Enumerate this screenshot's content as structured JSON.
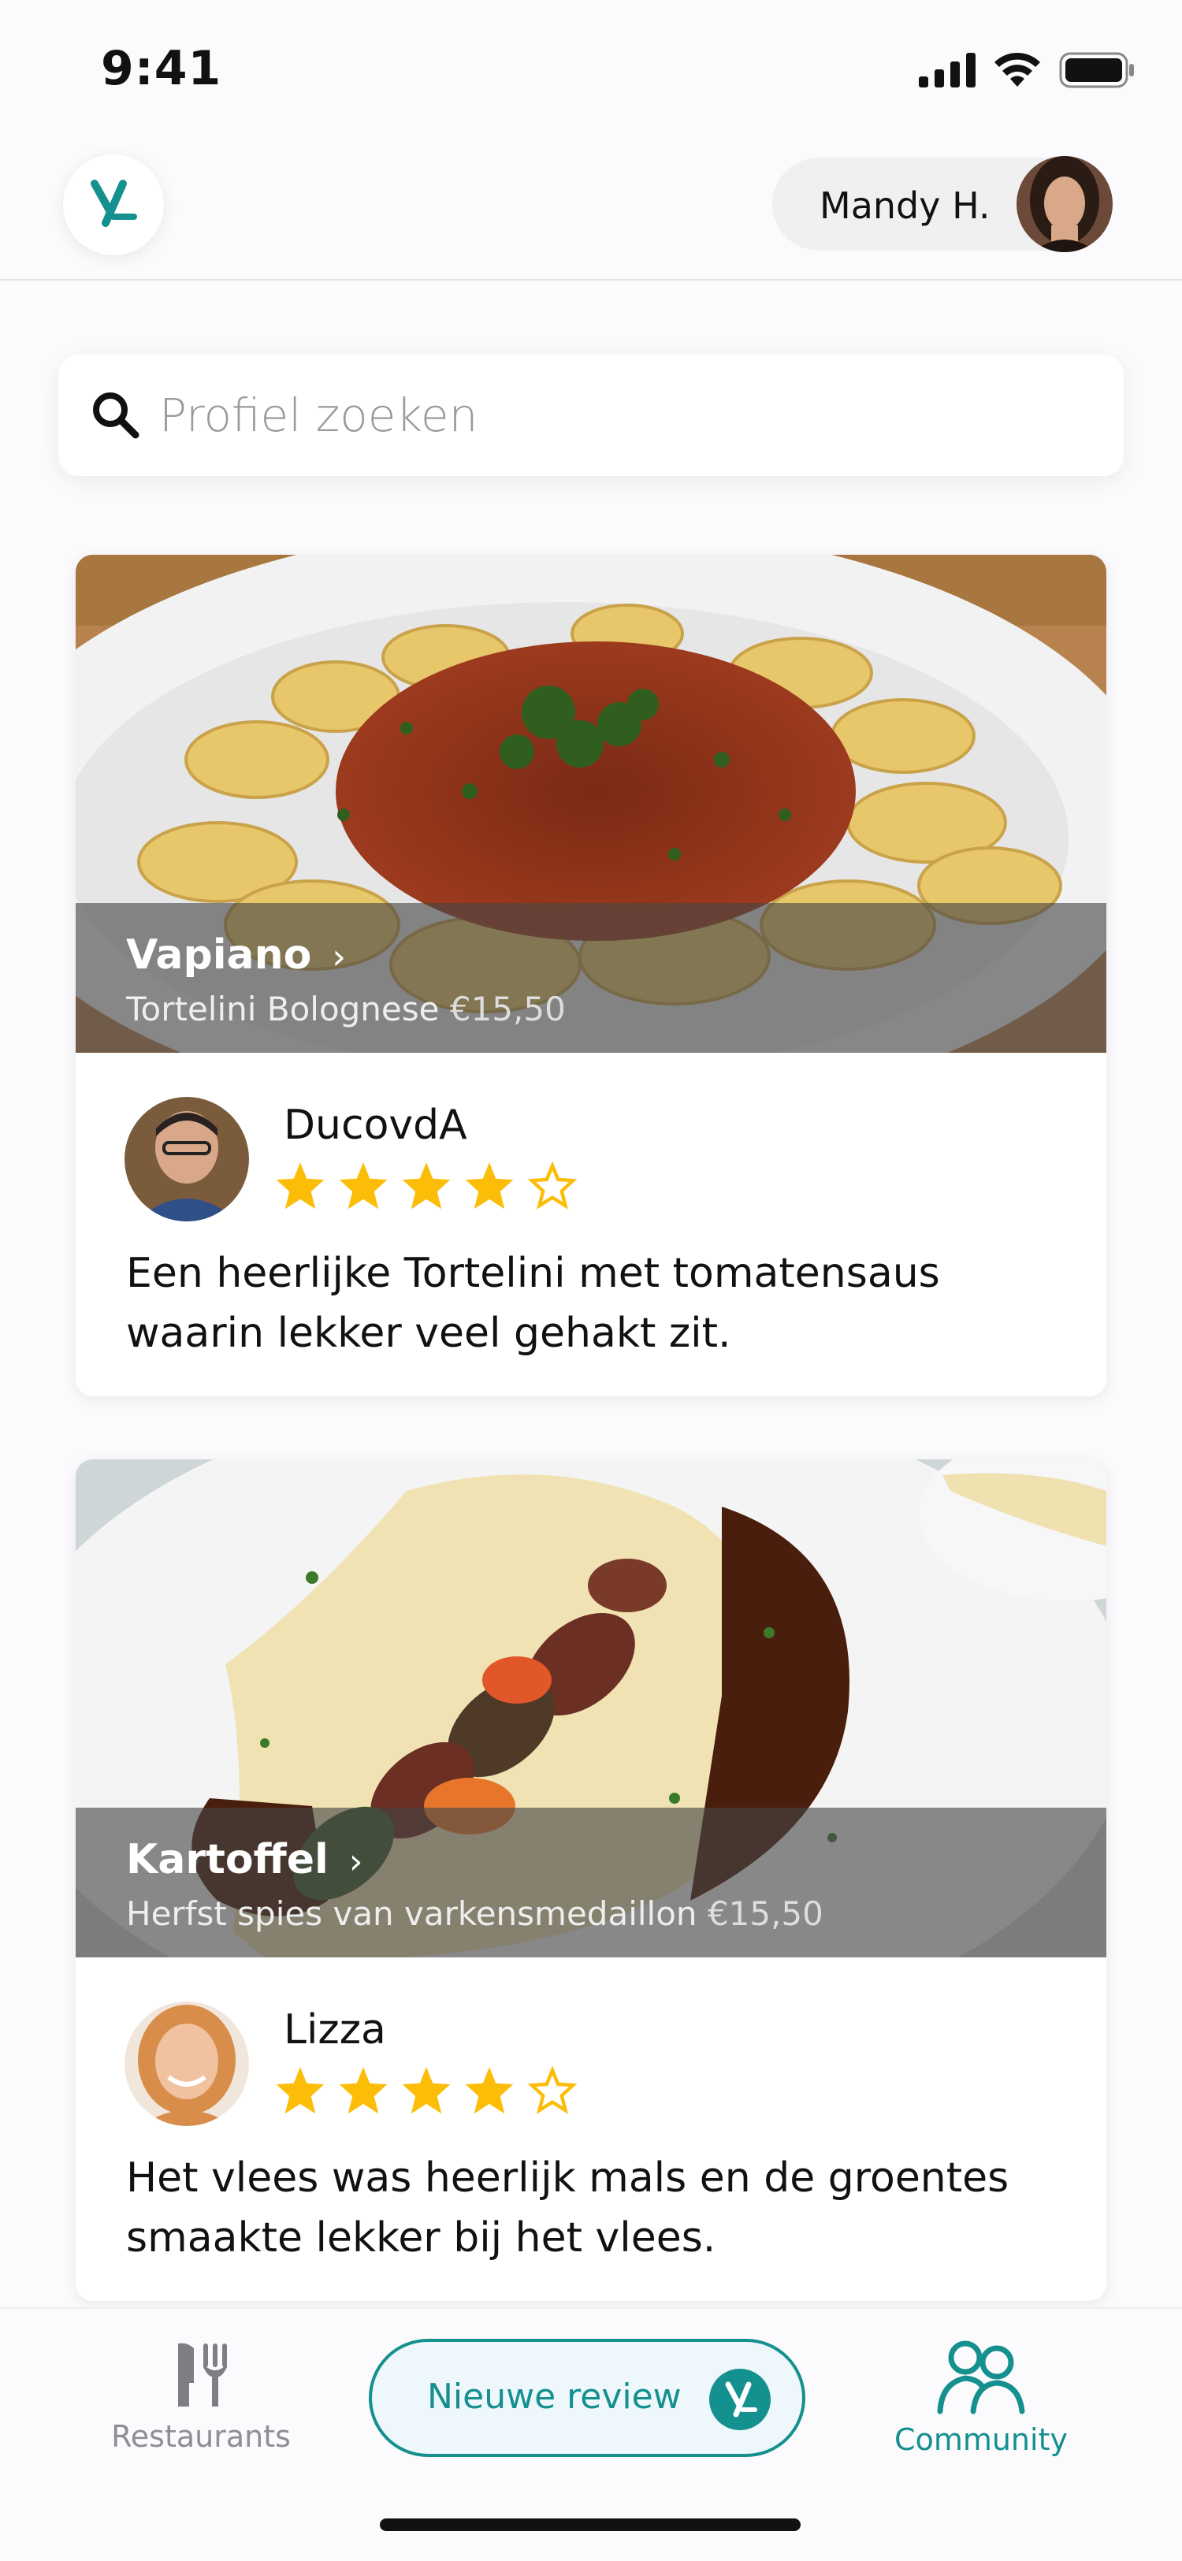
{
  "status_bar": {
    "time": "9:41"
  },
  "header": {
    "user_name": "Mandy H."
  },
  "search": {
    "placeholder": "Profiel zoeken"
  },
  "posts": [
    {
      "restaurant": "Vapiano",
      "dish": "Tortelini Bolognese",
      "price": "€15,50",
      "reviewer": "DucovdA",
      "rating": 4,
      "max_rating": 5,
      "review": "Een heerlijke Tortelini met tomatensaus waarin lekker veel gehakt zit."
    },
    {
      "restaurant": "Kartoffel",
      "dish": "Herfst spies van varkensmedaillon",
      "price": "€15,50",
      "reviewer": "Lizza",
      "rating": 4,
      "max_rating": 5,
      "review": "Het vlees was heerlijk mals en de groentes smaakte lekker bij het vlees."
    }
  ],
  "nav": {
    "restaurants_label": "Restaurants",
    "new_review_label": "Nieuwe review",
    "community_label": "Community"
  },
  "colors": {
    "accent": "#14908e",
    "star": "#fbbd08",
    "text": "#111111"
  }
}
